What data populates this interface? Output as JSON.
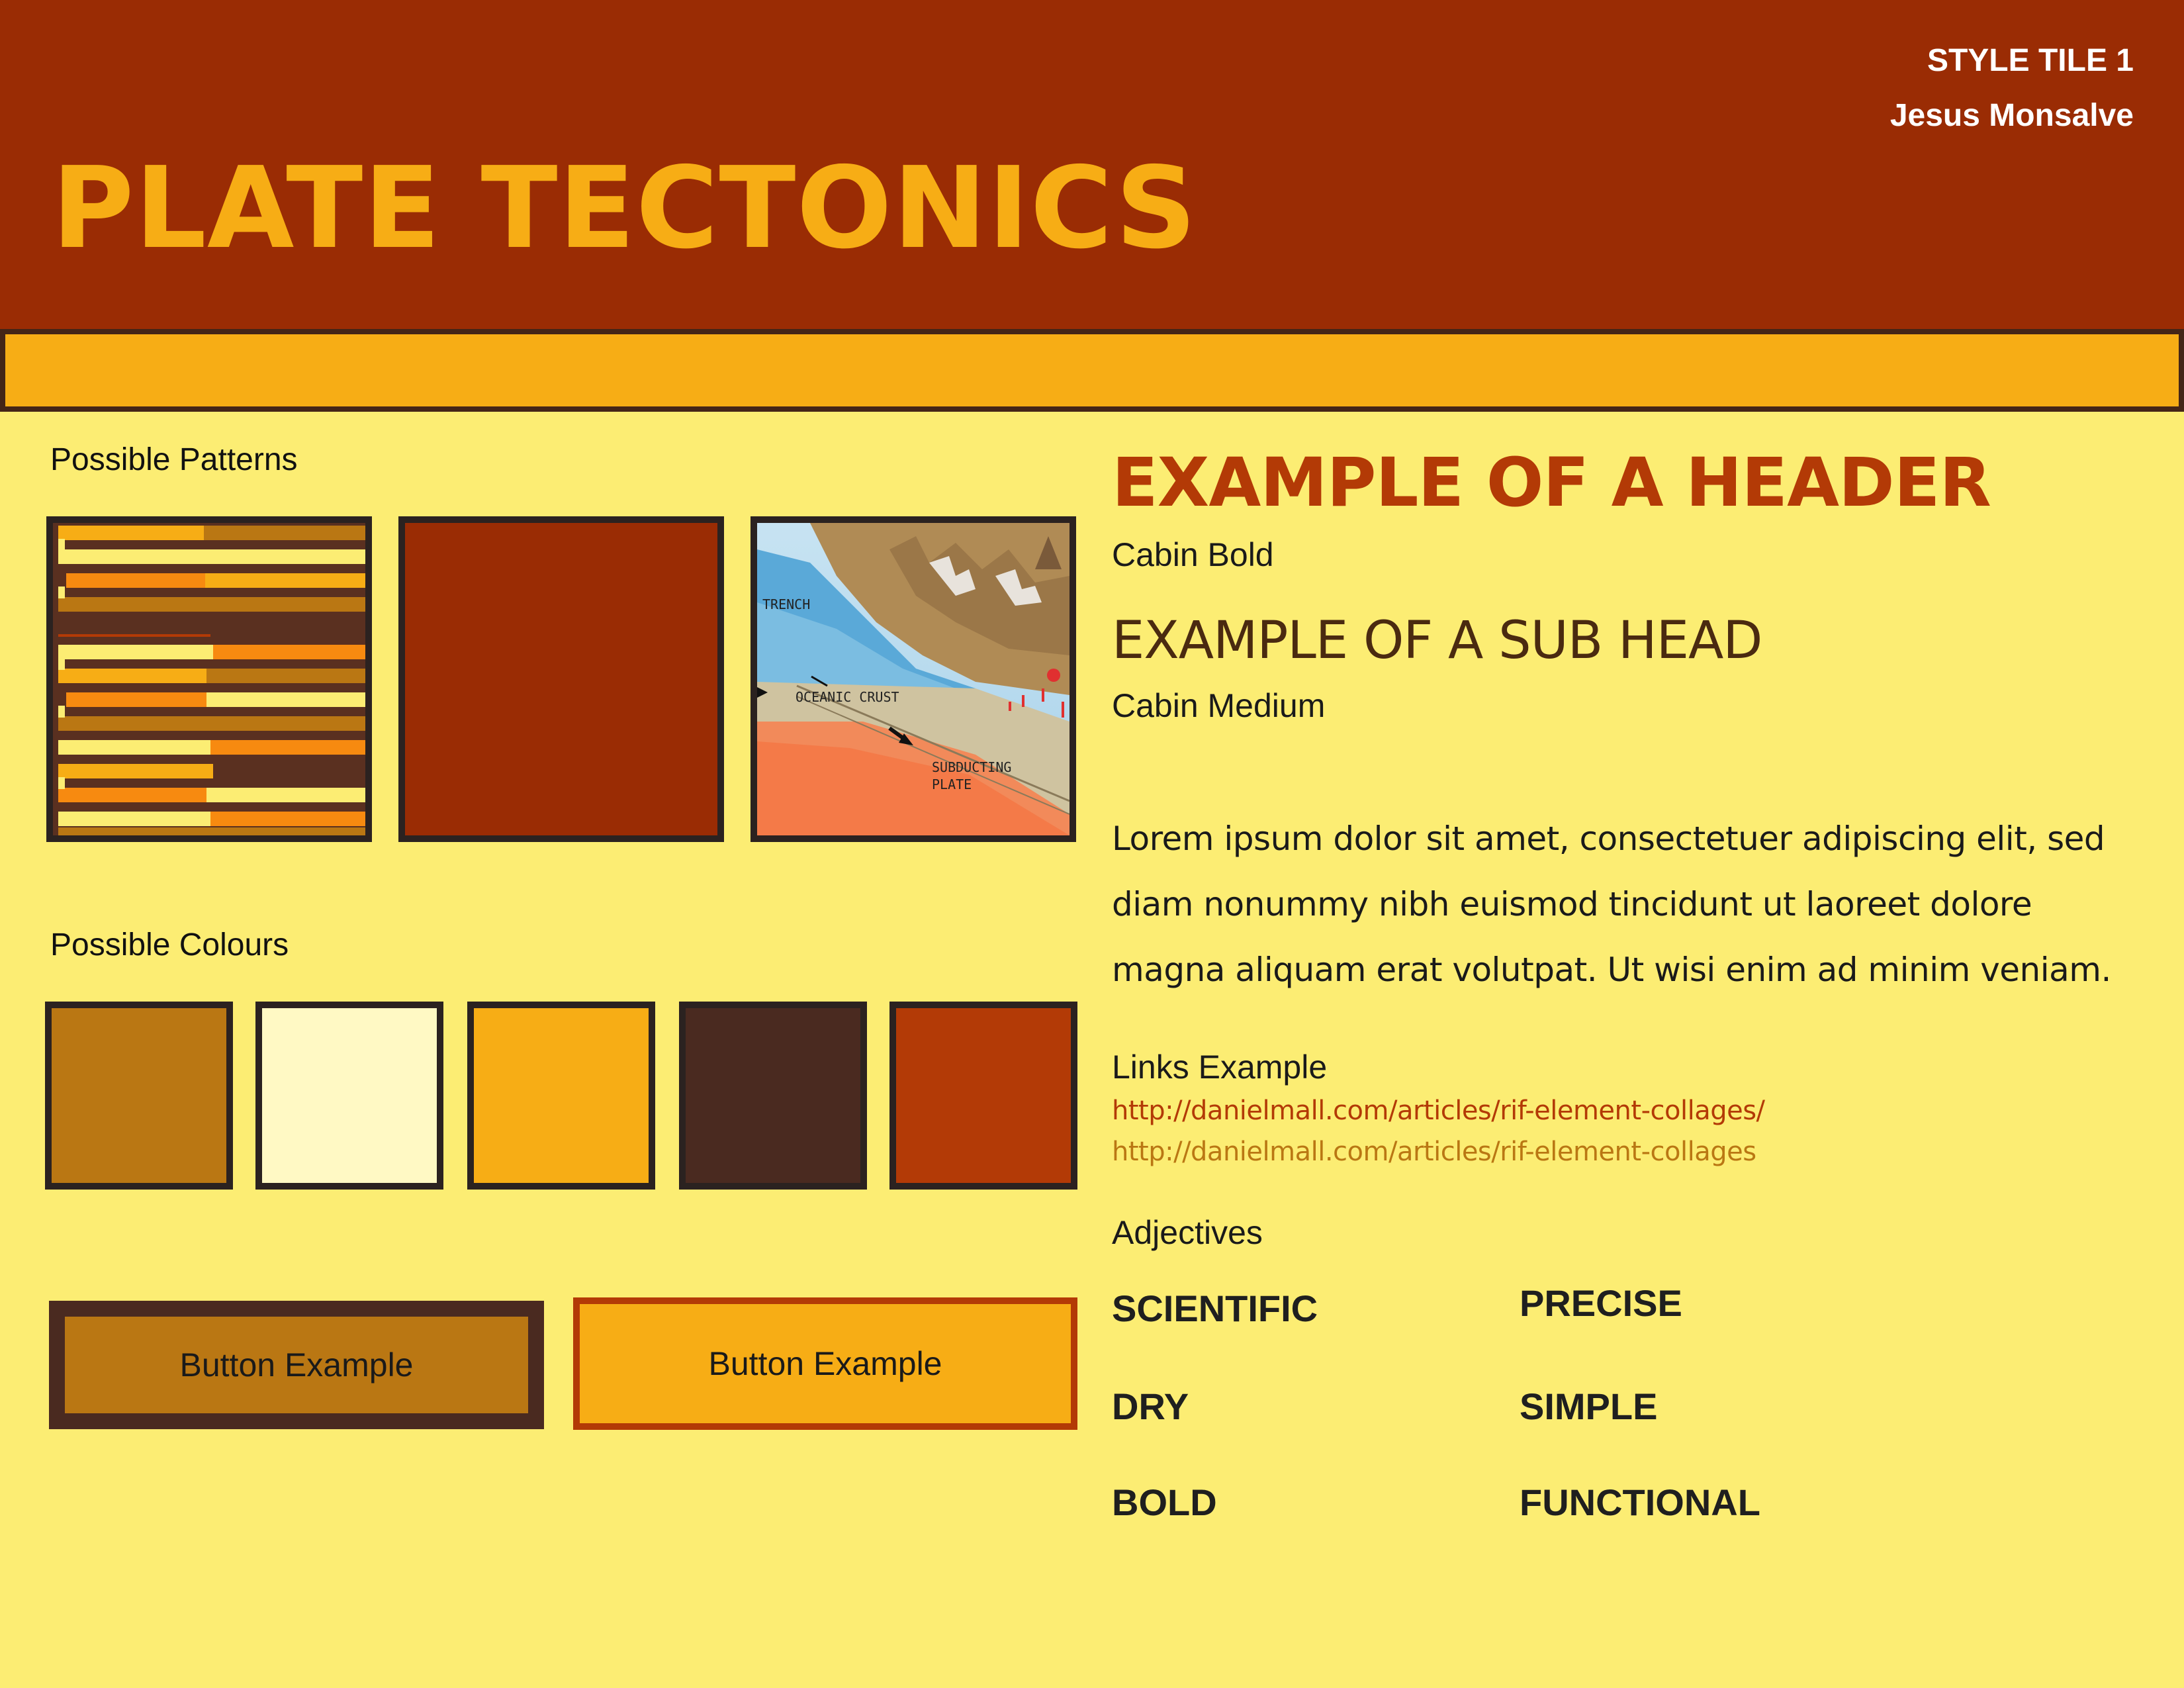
{
  "header": {
    "title": "PLATE TECTONICS",
    "tile_label": "STYLE TILE 1",
    "author": "Jesus Monsalve"
  },
  "patterns": {
    "label": "Possible Patterns",
    "diagram_labels": {
      "trench": "TRENCH",
      "oceanic_crust": "OCEANIC CRUST",
      "subducting_plate_1": "SUBDUCTING",
      "subducting_plate_2": "PLATE"
    }
  },
  "colours": {
    "label": "Possible Colours",
    "swatches": [
      "#ba7713",
      "#fff9c4",
      "#f7ad15",
      "#4a2a20",
      "#b33a06"
    ]
  },
  "buttons": {
    "primary_label": "Button Example",
    "secondary_label": "Button Example"
  },
  "typography": {
    "header_example": "EXAMPLE OF A HEADER",
    "header_font": "Cabin Bold",
    "subhead_example": "EXAMPLE OF A SUB HEAD",
    "subhead_font": "Cabin Medium",
    "body": "Lorem ipsum dolor sit amet, consectetuer adipiscing elit, sed diam nonummy nibh euismod tincidunt ut laoreet dolore magna aliquam erat volutpat. Ut wisi enim ad minim veniam."
  },
  "links": {
    "label": "Links Example",
    "link_1": "http://danielmall.com/articles/rif-element-collages/",
    "link_2": "http://danielmall.com/articles/rif-element-collages"
  },
  "adjectives": {
    "label": "Adjectives",
    "items": [
      "SCIENTIFIC",
      "PRECISE",
      "DRY",
      "SIMPLE",
      "BOLD",
      "FUNCTIONAL"
    ]
  }
}
